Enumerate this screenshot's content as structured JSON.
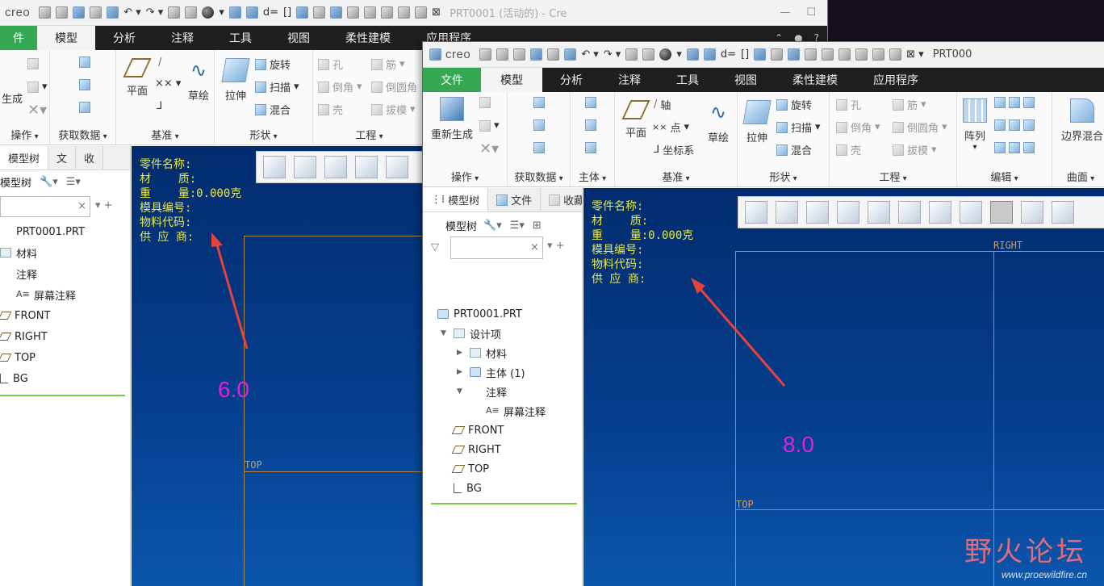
{
  "app": {
    "logo": "creo",
    "title_back": "PRT0001 (活动的) - Cre",
    "title_front": "PRT000"
  },
  "tabs": [
    "文件",
    "模型",
    "分析",
    "注释",
    "工具",
    "视图",
    "柔性建模",
    "应用程序"
  ],
  "back_tabs": [
    "件",
    "模型",
    "分析",
    "注释",
    "工具",
    "视图",
    "柔性建模",
    "应用程序"
  ],
  "ribbon": {
    "regen": "重新生成",
    "regen_short": "生成",
    "operations": "操作",
    "operations_short": "操作",
    "get_data": "获取数据",
    "body": "主体",
    "datum": "基准",
    "shape": "形状",
    "engineering": "工程",
    "edit": "编辑",
    "surface": "曲面",
    "plane": "平面",
    "axis": "轴",
    "point": "点",
    "csys": "坐标系",
    "sketch": "草绘",
    "extrude": "拉伸",
    "revolve": "旋转",
    "sweep": "扫描",
    "blend": "混合",
    "hole": "孔",
    "round": "倒圆角",
    "chamfer": "倒角",
    "shell": "壳",
    "rib": "筋",
    "draft": "拔模",
    "pattern": "阵列",
    "boundary_blend": "边界混合"
  },
  "tree_tabs": [
    "模型树",
    "文件",
    "收藏"
  ],
  "tree_tabs_back": [
    "模型树",
    "文",
    "收"
  ],
  "tree_toolbar": "模型树",
  "tree_front": [
    {
      "label": "PRT0001.PRT",
      "indent": 0,
      "icon": "part",
      "arrow": ""
    },
    {
      "label": "设计项",
      "indent": 1,
      "icon": "folder",
      "arrow": "▼"
    },
    {
      "label": "材料",
      "indent": 2,
      "icon": "folder",
      "arrow": "▶"
    },
    {
      "label": "主体 (1)",
      "indent": 2,
      "icon": "part",
      "arrow": "▶"
    },
    {
      "label": "注释",
      "indent": 2,
      "icon": "none",
      "arrow": "▼"
    },
    {
      "label": "屏幕注释",
      "indent": 3,
      "icon": "note",
      "arrow": ""
    },
    {
      "label": "FRONT",
      "indent": 1,
      "icon": "plane",
      "arrow": ""
    },
    {
      "label": "RIGHT",
      "indent": 1,
      "icon": "plane",
      "arrow": ""
    },
    {
      "label": "TOP",
      "indent": 1,
      "icon": "plane",
      "arrow": ""
    },
    {
      "label": "BG",
      "indent": 1,
      "icon": "csys",
      "arrow": ""
    }
  ],
  "tree_back": [
    {
      "label": "PRT0001.PRT",
      "indent": 0,
      "icon": "none"
    },
    {
      "label": "材料",
      "indent": 0,
      "icon": "folder"
    },
    {
      "label": "注释",
      "indent": 0,
      "icon": "none"
    },
    {
      "label": "屏幕注释",
      "indent": 1,
      "icon": "note"
    },
    {
      "label": "FRONT",
      "indent": 0,
      "icon": "plane"
    },
    {
      "label": "RIGHT",
      "indent": 0,
      "icon": "plane"
    },
    {
      "label": "TOP",
      "indent": 0,
      "icon": "plane"
    },
    {
      "label": "BG",
      "indent": 0,
      "icon": "csys"
    }
  ],
  "annotation": "零件名称:\n材    质:\n重    量:0.000克\n模具编号:\n物料代码:\n供 应 商:",
  "datum_labels": {
    "top": "TOP",
    "right": "RIGHT"
  },
  "versions": {
    "back": "6.0",
    "front": "8.0"
  },
  "watermark": {
    "cn": "野火论坛",
    "url": "www.proewildfire.cn"
  },
  "colors": {
    "file_tab": "#34a853",
    "annotation": "#e8e94c",
    "version_text": "#e020e0",
    "arrow": "#e8433a",
    "tree_separator": "#7ac943"
  }
}
